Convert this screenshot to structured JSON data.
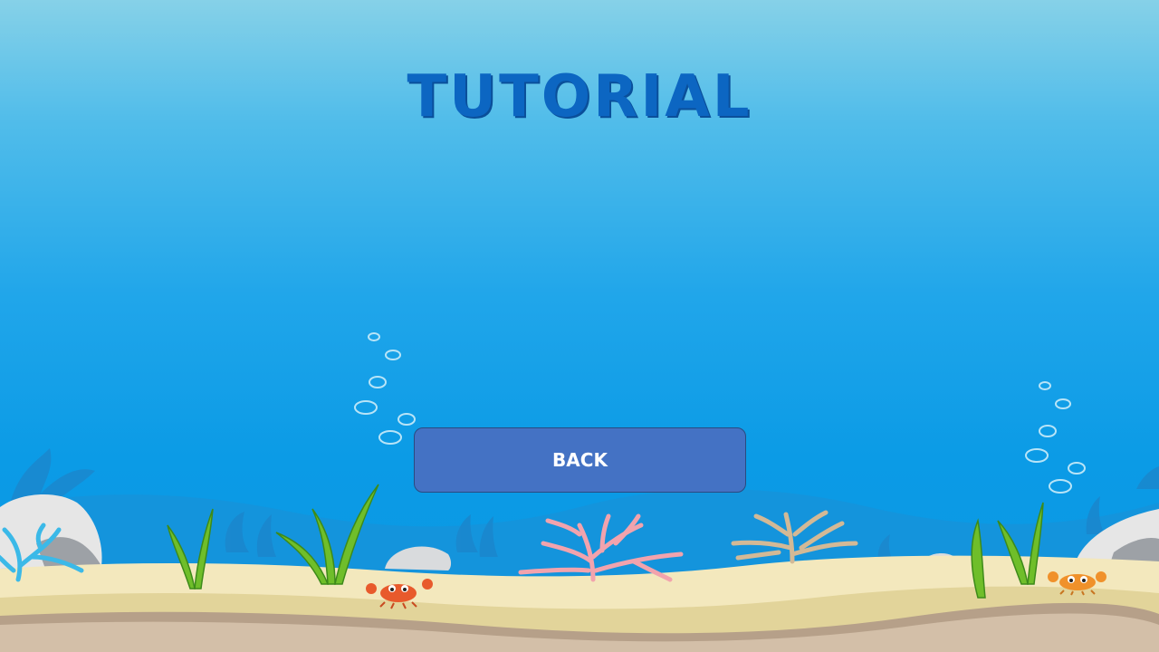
{
  "screen": {
    "title": "TUTORIAL",
    "back_button_label": "BACK"
  },
  "colors": {
    "sky_top": "#86d1e8",
    "water_bottom": "#0a97e2",
    "title": "#0c66c2",
    "button_fill": "#4472c4",
    "button_text": "#ffffff",
    "sand": "#f2e6b8",
    "seabed_rock": "#c9b39c"
  }
}
